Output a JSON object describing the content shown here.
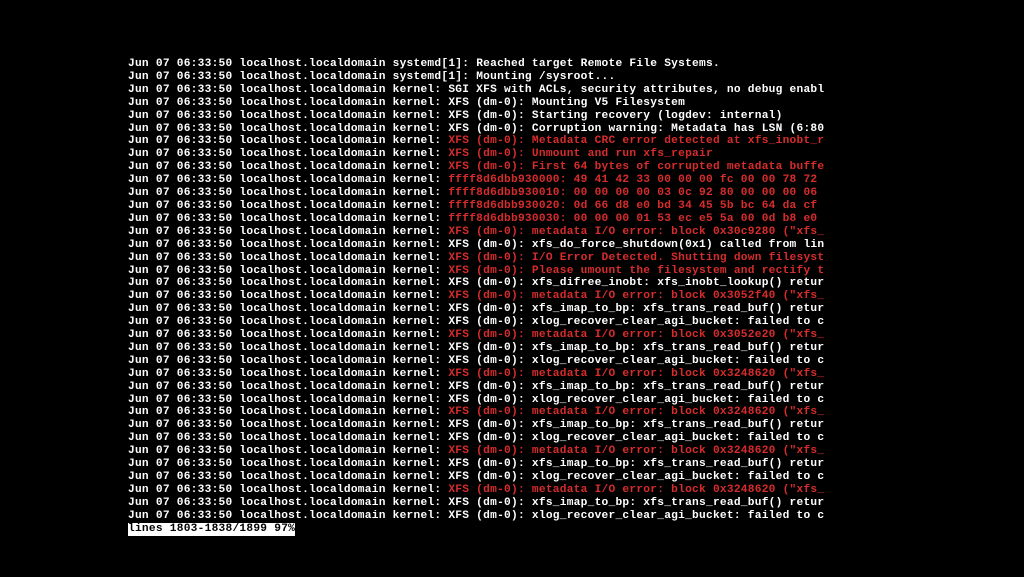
{
  "common": {
    "timestamp": "Jun 07 06:33:50",
    "host": "localhost.localdomain"
  },
  "lines": [
    {
      "proc": "systemd[1]:",
      "color": "white",
      "msg": "Reached target Remote File Systems."
    },
    {
      "proc": "systemd[1]:",
      "color": "white",
      "msg": "Mounting /sysroot..."
    },
    {
      "proc": "kernel:",
      "color": "white",
      "msg": "SGI XFS with ACLs, security attributes, no debug enabl"
    },
    {
      "proc": "kernel:",
      "color": "white",
      "msg": "XFS (dm-0): Mounting V5 Filesystem"
    },
    {
      "proc": "kernel:",
      "color": "white",
      "msg": "XFS (dm-0): Starting recovery (logdev: internal)"
    },
    {
      "proc": "kernel:",
      "color": "white",
      "msg": "XFS (dm-0): Corruption warning: Metadata has LSN (6:80"
    },
    {
      "proc": "kernel:",
      "color": "red",
      "msg": "XFS (dm-0): Metadata CRC error detected at xfs_inobt_r"
    },
    {
      "proc": "kernel:",
      "color": "red",
      "msg": "XFS (dm-0): Unmount and run xfs_repair"
    },
    {
      "proc": "kernel:",
      "color": "red",
      "msg": "XFS (dm-0): First 64 bytes of corrupted metadata buffe"
    },
    {
      "proc": "kernel:",
      "color": "red",
      "msg": "ffff8d6dbb930000: 49 41 42 33 00 00 00 fc 00 00 78 72 "
    },
    {
      "proc": "kernel:",
      "color": "red",
      "msg": "ffff8d6dbb930010: 00 00 00 00 03 0c 92 80 00 00 00 06 "
    },
    {
      "proc": "kernel:",
      "color": "red",
      "msg": "ffff8d6dbb930020: 0d 66 d8 e0 bd 34 45 5b bc 64 da cf "
    },
    {
      "proc": "kernel:",
      "color": "red",
      "msg": "ffff8d6dbb930030: 00 00 00 01 53 ec e5 5a 00 0d b8 e0 "
    },
    {
      "proc": "kernel:",
      "color": "red",
      "msg": "XFS (dm-0): metadata I/O error: block 0x30c9280 (\"xfs_"
    },
    {
      "proc": "kernel:",
      "color": "white",
      "msg": "XFS (dm-0): xfs_do_force_shutdown(0x1) called from lin"
    },
    {
      "proc": "kernel:",
      "color": "red",
      "msg": "XFS (dm-0): I/O Error Detected. Shutting down filesyst"
    },
    {
      "proc": "kernel:",
      "color": "red",
      "msg": "XFS (dm-0): Please umount the filesystem and rectify t"
    },
    {
      "proc": "kernel:",
      "color": "white",
      "msg": "XFS (dm-0): xfs_difree_inobt: xfs_inobt_lookup() retur"
    },
    {
      "proc": "kernel:",
      "color": "red",
      "msg": "XFS (dm-0): metadata I/O error: block 0x3052f40 (\"xfs_"
    },
    {
      "proc": "kernel:",
      "color": "white",
      "msg": "XFS (dm-0): xfs_imap_to_bp: xfs_trans_read_buf() retur"
    },
    {
      "proc": "kernel:",
      "color": "white",
      "msg": "XFS (dm-0): xlog_recover_clear_agi_bucket: failed to c"
    },
    {
      "proc": "kernel:",
      "color": "red",
      "msg": "XFS (dm-0): metadata I/O error: block 0x3052e20 (\"xfs_"
    },
    {
      "proc": "kernel:",
      "color": "white",
      "msg": "XFS (dm-0): xfs_imap_to_bp: xfs_trans_read_buf() retur"
    },
    {
      "proc": "kernel:",
      "color": "white",
      "msg": "XFS (dm-0): xlog_recover_clear_agi_bucket: failed to c"
    },
    {
      "proc": "kernel:",
      "color": "red",
      "msg": "XFS (dm-0): metadata I/O error: block 0x3248620 (\"xfs_"
    },
    {
      "proc": "kernel:",
      "color": "white",
      "msg": "XFS (dm-0): xfs_imap_to_bp: xfs_trans_read_buf() retur"
    },
    {
      "proc": "kernel:",
      "color": "white",
      "msg": "XFS (dm-0): xlog_recover_clear_agi_bucket: failed to c"
    },
    {
      "proc": "kernel:",
      "color": "red",
      "msg": "XFS (dm-0): metadata I/O error: block 0x3248620 (\"xfs_"
    },
    {
      "proc": "kernel:",
      "color": "white",
      "msg": "XFS (dm-0): xfs_imap_to_bp: xfs_trans_read_buf() retur"
    },
    {
      "proc": "kernel:",
      "color": "white",
      "msg": "XFS (dm-0): xlog_recover_clear_agi_bucket: failed to c"
    },
    {
      "proc": "kernel:",
      "color": "red",
      "msg": "XFS (dm-0): metadata I/O error: block 0x3248620 (\"xfs_"
    },
    {
      "proc": "kernel:",
      "color": "white",
      "msg": "XFS (dm-0): xfs_imap_to_bp: xfs_trans_read_buf() retur"
    },
    {
      "proc": "kernel:",
      "color": "white",
      "msg": "XFS (dm-0): xlog_recover_clear_agi_bucket: failed to c"
    },
    {
      "proc": "kernel:",
      "color": "red",
      "msg": "XFS (dm-0): metadata I/O error: block 0x3248620 (\"xfs_"
    },
    {
      "proc": "kernel:",
      "color": "white",
      "msg": "XFS (dm-0): xfs_imap_to_bp: xfs_trans_read_buf() retur"
    },
    {
      "proc": "kernel:",
      "color": "white",
      "msg": "XFS (dm-0): xlog_recover_clear_agi_bucket: failed to c"
    }
  ],
  "status": "lines 1803-1838/1899 97%"
}
